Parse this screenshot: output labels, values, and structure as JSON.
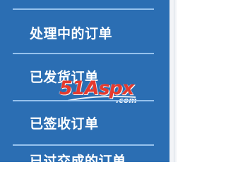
{
  "menu": {
    "items": [
      {
        "label": "处理中的订单"
      },
      {
        "label": "已发货订单"
      },
      {
        "label": "已签收订单"
      },
      {
        "label": "已过交成的订单"
      }
    ]
  },
  "watermark": {
    "logo_prefix": "51",
    "logo_main": "Aspx",
    "logo_suffix": ".com"
  },
  "colors": {
    "panel_bg": "#2b6eb3",
    "divider": "#9cc6f0",
    "text": "#ffffff",
    "watermark": "#e53a2e"
  }
}
